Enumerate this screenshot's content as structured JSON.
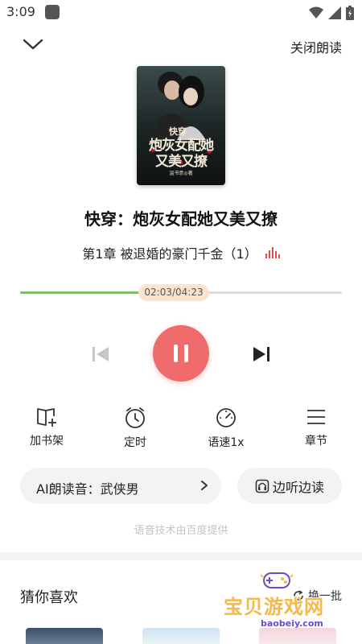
{
  "status_bar": {
    "time": "3:09",
    "icons": [
      "wifi-icon",
      "signal-icon",
      "battery-icon"
    ]
  },
  "top_bar": {
    "back_icon": "chevron-down-icon",
    "close_read_label": "关闭朗读"
  },
  "book": {
    "cover_title_lines": [
      "快穿",
      "炮灰女配她",
      "又美又撩"
    ],
    "cover_author": "温书意◎著",
    "title": "快穿：炮灰女配她又美又撩",
    "chapter": "第1章 被退婚的豪门千金（1）"
  },
  "player": {
    "progress_text": "02:03/04:23",
    "progress_fraction": 0.467,
    "progress_color": "#7dbd6b",
    "play_button_color": "#f06b6b",
    "state": "playing"
  },
  "actions": [
    {
      "label": "加书架",
      "icon": "add-bookshelf-icon"
    },
    {
      "label": "定时",
      "icon": "clock-icon"
    },
    {
      "label": "语速1x",
      "icon": "speedometer-icon"
    },
    {
      "label": "章节",
      "icon": "menu-list-icon"
    }
  ],
  "voice": {
    "label": "AI朗读音：武侠男",
    "listen_label": "边听边读"
  },
  "provider_note": "语音技术由百度提供",
  "recommend": {
    "title": "猜你喜欢",
    "refresh_label": "换一批"
  },
  "watermark": {
    "text": "宝贝游戏网",
    "url": "baobeiy.com"
  }
}
